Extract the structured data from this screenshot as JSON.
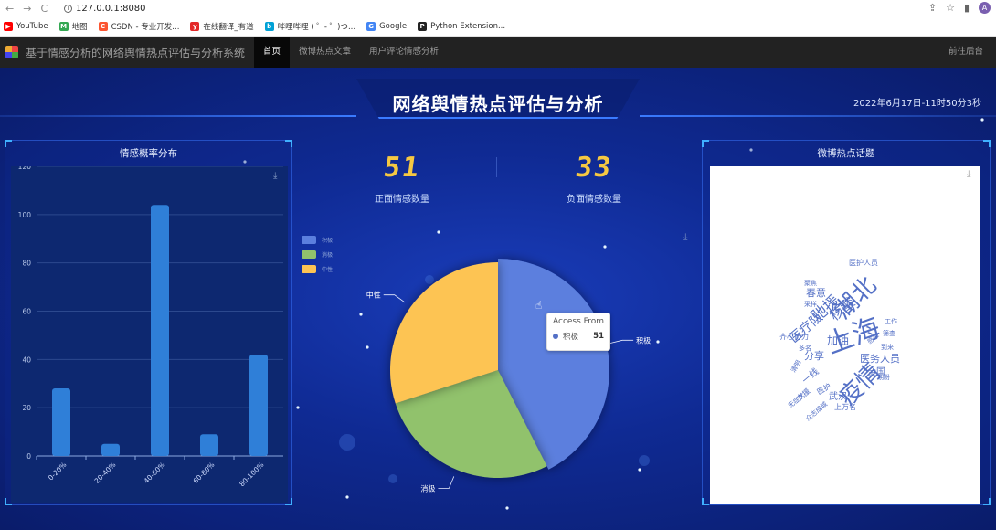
{
  "browser": {
    "url": "127.0.0.1:8080",
    "nav": [
      "←",
      "→",
      "C"
    ],
    "bookmarks": [
      {
        "label": "YouTube",
        "color": "#ff0000",
        "glyph": "▶"
      },
      {
        "label": "地图",
        "color": "#34a853",
        "glyph": "M"
      },
      {
        "label": "CSDN - 专业开发...",
        "color": "#fc5531",
        "glyph": "C"
      },
      {
        "label": "在线翻译_有道",
        "color": "#e32828",
        "glyph": "y"
      },
      {
        "label": "哔哩哔哩 ( ゜- ゜)つ...",
        "color": "#00a1d6",
        "glyph": "b"
      },
      {
        "label": "Google",
        "color": "#4285f4",
        "glyph": "G"
      },
      {
        "label": "Python Extension...",
        "color": "#222222",
        "glyph": "P"
      }
    ],
    "avatar_glyph": "A"
  },
  "navbar": {
    "brand": "基于情感分析的网络舆情热点评估与分析系统",
    "items": [
      {
        "label": "首页",
        "active": true
      },
      {
        "label": "微博热点文章",
        "active": false
      },
      {
        "label": "用户评论情感分析",
        "active": false
      }
    ],
    "right_link": "前往后台"
  },
  "dashboard": {
    "title": "网络舆情热点评估与分析",
    "clock": "2022年6月17日-11时50分3秒",
    "left_panel_title": "情感概率分布",
    "right_panel_title": "微博热点话题",
    "positive": {
      "value": "51",
      "label": "正面情感数量"
    },
    "negative": {
      "value": "33",
      "label": "负面情感数量"
    },
    "tooltip": {
      "title": "Access From",
      "name": "积极",
      "value": "51"
    }
  },
  "chart_data": [
    {
      "type": "bar",
      "title": "情感概率分布",
      "categories": [
        "0-20%",
        "20-40%",
        "40-60%",
        "60-80%",
        "80-100%"
      ],
      "values": [
        28,
        5,
        104,
        9,
        42
      ],
      "yticks": [
        0,
        20,
        40,
        60,
        80,
        100,
        120
      ],
      "ylim": [
        0,
        120
      ],
      "color": "#2f7fd8"
    },
    {
      "type": "pie",
      "slices": [
        {
          "name": "积极",
          "value": 51,
          "color": "#5b7fde"
        },
        {
          "name": "消极",
          "value": 33,
          "color": "#91c26c"
        },
        {
          "name": "中性",
          "value": 36,
          "color": "#fdc453"
        }
      ],
      "legend_position": "top-left"
    }
  ],
  "wordcloud": {
    "color": "#5470c6",
    "words": [
      {
        "text": "湖北",
        "size": 26,
        "rotate": -45
      },
      {
        "text": "上海",
        "size": 30,
        "rotate": -20
      },
      {
        "text": "疫情",
        "size": 26,
        "rotate": -45
      },
      {
        "text": "驰援",
        "size": 17,
        "rotate": -40
      },
      {
        "text": "核酸",
        "size": 15,
        "rotate": -40
      },
      {
        "text": "医疗队",
        "size": 14,
        "rotate": -40
      },
      {
        "text": "加油",
        "size": 12,
        "rotate": 0
      },
      {
        "text": "医务人员",
        "size": 11,
        "rotate": 0
      },
      {
        "text": "医护人员",
        "size": 8,
        "rotate": 0
      },
      {
        "text": "春意",
        "size": 11,
        "rotate": 0
      },
      {
        "text": "分享",
        "size": 11,
        "rotate": 0
      },
      {
        "text": "全国",
        "size": 10,
        "rotate": 0
      },
      {
        "text": "武汉",
        "size": 10,
        "rotate": 0
      },
      {
        "text": "上万名",
        "size": 8,
        "rotate": 0
      },
      {
        "text": "齐心协力",
        "size": 8,
        "rotate": 0
      },
      {
        "text": "聚焦",
        "size": 7,
        "rotate": 0
      },
      {
        "text": "采样",
        "size": 7,
        "rotate": 0
      },
      {
        "text": "多名",
        "size": 7,
        "rotate": 0
      },
      {
        "text": "工作",
        "size": 7,
        "rotate": 0
      },
      {
        "text": "筛查",
        "size": 7,
        "rotate": 0
      },
      {
        "text": "到来",
        "size": 7,
        "rotate": 0
      },
      {
        "text": "期盼",
        "size": 7,
        "rotate": 0
      },
      {
        "text": "清明",
        "size": 7,
        "rotate": -60
      },
      {
        "text": "医护",
        "size": 8,
        "rotate": -30
      },
      {
        "text": "一线",
        "size": 10,
        "rotate": -40
      },
      {
        "text": "支援",
        "size": 8,
        "rotate": -40
      },
      {
        "text": "无症状",
        "size": 7,
        "rotate": -40
      },
      {
        "text": "众志成城",
        "size": 7,
        "rotate": -40
      },
      {
        "text": "感染",
        "size": 7,
        "rotate": -40
      }
    ]
  }
}
